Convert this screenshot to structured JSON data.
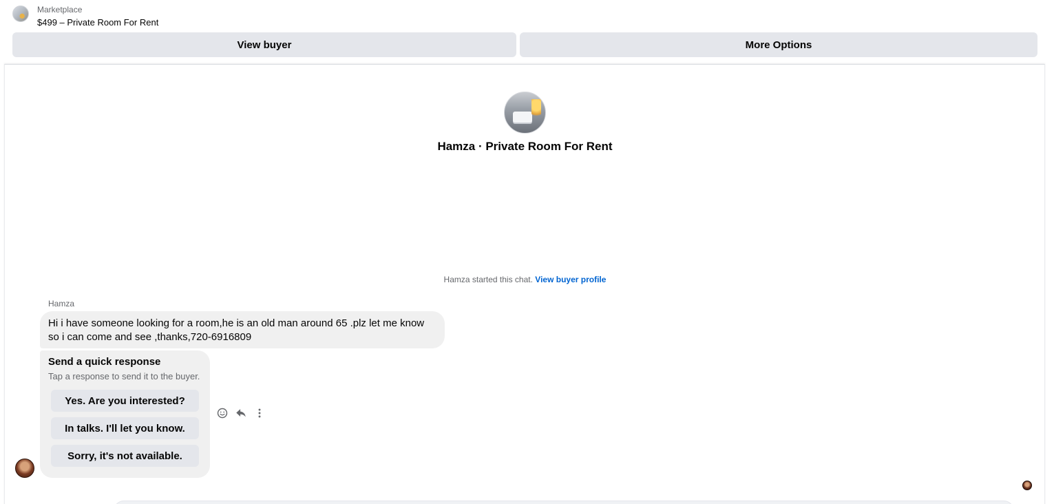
{
  "header": {
    "subtitle": "Marketplace",
    "listing_title": "$499 – Private Room For Rent",
    "view_buyer_label": "View buyer",
    "more_options_label": "More Options"
  },
  "chat": {
    "profile_name": "Hamza · Private Room For Rent",
    "started_text": "Hamza started this chat.",
    "view_profile_link": "View buyer profile",
    "sender": "Hamza",
    "message": "Hi i have someone looking for a room,he is an old man around 65 .plz let me know so i can come and see ,thanks,720-6916809",
    "quick_response": {
      "title": "Send a quick response",
      "subtitle": "Tap a response to send it to the buyer.",
      "options": [
        "Yes. Are you interested?",
        "In talks. I'll let you know.",
        "Sorry, it's not available."
      ]
    },
    "actions": [
      "smiley-icon",
      "reply-icon",
      "more-vertical-icon"
    ]
  },
  "colors": {
    "button_bg": "#e4e6eb",
    "bubble_bg": "#f0f0f0",
    "link": "#0064d1",
    "secondary_text": "#65676b"
  }
}
